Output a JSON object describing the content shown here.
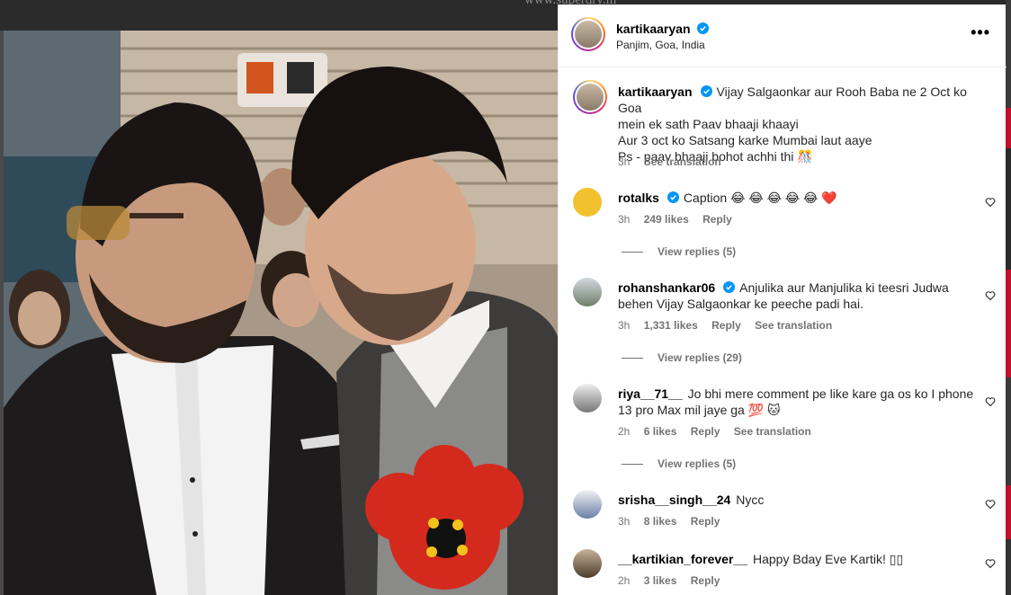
{
  "backdrop": {
    "url_text": "www.superdry.in"
  },
  "post": {
    "author": "kartikaaryan",
    "location": "Panjim, Goa, India",
    "more_label": "•••",
    "caption": {
      "username": "kartikaaryan",
      "line1": "Vijay Salgaonkar aur Rooh Baba ne 2 Oct ko Goa",
      "line2": "mein ek sath Paav bhaaji khaayi",
      "line3": "Aur 3 oct ko Satsang karke Mumbai laut aaye",
      "line4": "Ps - paav bhaaji bohot achhi thi 🎊",
      "time": "3h",
      "translate": "See translation"
    }
  },
  "comments": [
    {
      "username": "rotalks",
      "verified": true,
      "text": "Caption 😂 😂 😂 😂 😂 ❤️",
      "time": "3h",
      "likes": "249 likes",
      "reply": "Reply",
      "translate": "",
      "view_replies": "View replies (5)"
    },
    {
      "username": "rohanshankar06",
      "verified": true,
      "text": "Anjulika aur Manjulika ki teesri Judwa behen Vijay Salgaonkar ke peeche padi hai.",
      "time": "3h",
      "likes": "1,331 likes",
      "reply": "Reply",
      "translate": "See translation",
      "view_replies": "View replies (29)"
    },
    {
      "username": "riya__71__",
      "verified": false,
      "text": "Jo bhi mere comment pe like kare ga os ko I phone 13 pro Max mil jaye ga 💯 🐱",
      "time": "2h",
      "likes": "6 likes",
      "reply": "Reply",
      "translate": "See translation",
      "view_replies": "View replies (5)"
    },
    {
      "username": "srisha__singh__24",
      "verified": false,
      "text": "Nycc",
      "time": "3h",
      "likes": "8 likes",
      "reply": "Reply",
      "translate": "",
      "view_replies": ""
    },
    {
      "username": "__kartikian_forever__",
      "verified": false,
      "text": "Happy Bday Eve Kartik! ▯▯",
      "time": "2h",
      "likes": "3 likes",
      "reply": "Reply",
      "translate": "",
      "view_replies": ""
    }
  ],
  "colors": {
    "verified": "#0095f6",
    "meta_text": "#737373",
    "heart": "#ed4956"
  },
  "icons": [
    "verified-badge-icon",
    "more-options-icon",
    "heart-outline-icon",
    "heart-emoji"
  ]
}
